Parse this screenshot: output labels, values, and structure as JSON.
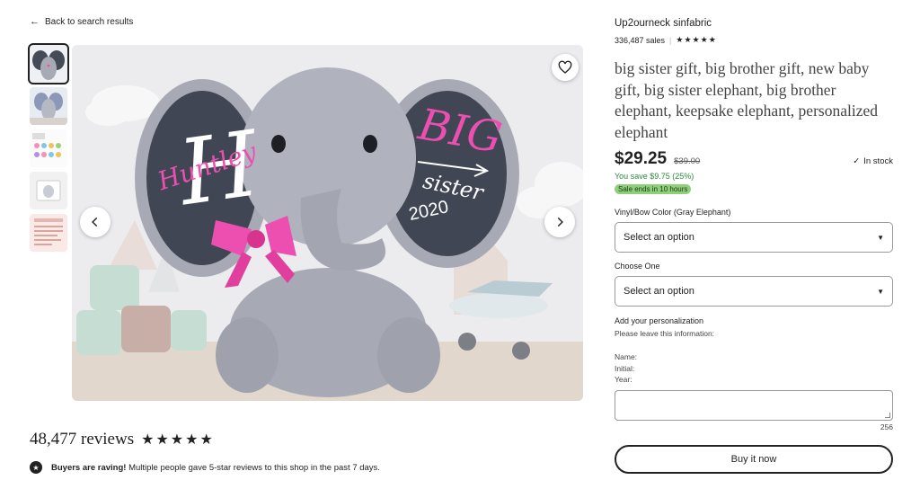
{
  "nav": {
    "back_label": "Back to search results"
  },
  "gallery": {
    "thumbnail_count": 5,
    "selected_index": 0,
    "image": {
      "ear_left_text": "H",
      "ear_left_name": "Huntley",
      "ear_right_big": "BIG",
      "ear_right_sister": "sister",
      "ear_right_year": "2020"
    }
  },
  "reviews": {
    "count_label": "48,477 reviews",
    "rating": 5
  },
  "raving": {
    "bold": "Buyers are raving!",
    "text": " Multiple people gave 5-star reviews to this shop in the past 7 days."
  },
  "shop": {
    "name": "Up2ourneck sinfabric",
    "sales": "336,487 sales",
    "rating": 5
  },
  "listing": {
    "title": "big sister gift, big brother gift, new baby gift, big sister elephant, big brother elephant, keepsake elephant, personalized elephant",
    "price": "$29.25",
    "original_price": "$39.00",
    "stock": "In stock",
    "savings": "You save $9.75 (25%)",
    "sale_badge": "Sale ends in 10 hours"
  },
  "options": [
    {
      "label": "Vinyl/Bow Color (Gray Elephant)",
      "value": "Select an option"
    },
    {
      "label": "Choose One",
      "value": "Select an option"
    }
  ],
  "personalization": {
    "label": "Add your personalization",
    "instruction": "Please leave this information:",
    "fields": [
      "Name:",
      "Initial:",
      "Year:"
    ],
    "char_limit": "256"
  },
  "buy_button": "Buy it now",
  "colors": {
    "sale_green": "#2b8a3e",
    "badge_green": "#8fce7a",
    "elephant_gray": "#a7aab5",
    "ribbon_pink": "#ec4fb0"
  },
  "icons": [
    "arrow-left-icon",
    "heart-icon",
    "chevron-left-icon",
    "chevron-right-icon",
    "star-icon",
    "check-icon",
    "caret-down-icon",
    "award-icon"
  ]
}
